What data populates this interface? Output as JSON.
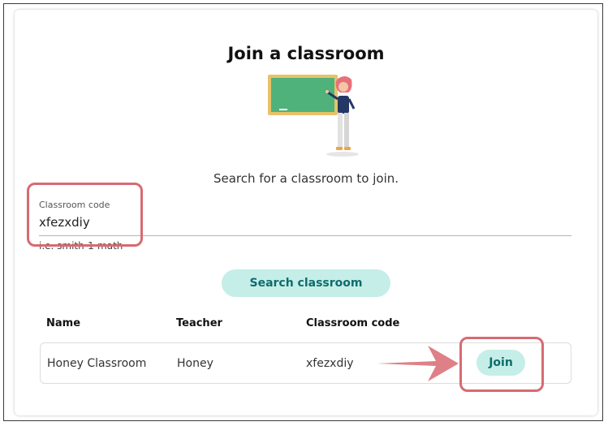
{
  "page": {
    "title": "Join a classroom",
    "subtitle": "Search for a classroom to join."
  },
  "search_form": {
    "label": "Classroom code",
    "value": "xfezxdiy",
    "helper": "i.e. smith-1-math",
    "button_label": "Search classroom"
  },
  "results": {
    "columns": [
      "Name",
      "Teacher",
      "Classroom code"
    ],
    "rows": [
      {
        "name": "Honey Classroom",
        "teacher": "Honey",
        "code": "xfezxdiy",
        "join_label": "Join"
      }
    ]
  },
  "colors": {
    "accent_bg": "#c5eee8",
    "accent_text": "#0e6d6c",
    "highlight": "#d86a72",
    "chalkboard": "#4fb27a",
    "frame": "#e8c26a"
  },
  "illustration": {
    "icon": "teacher-at-chalkboard-icon"
  }
}
